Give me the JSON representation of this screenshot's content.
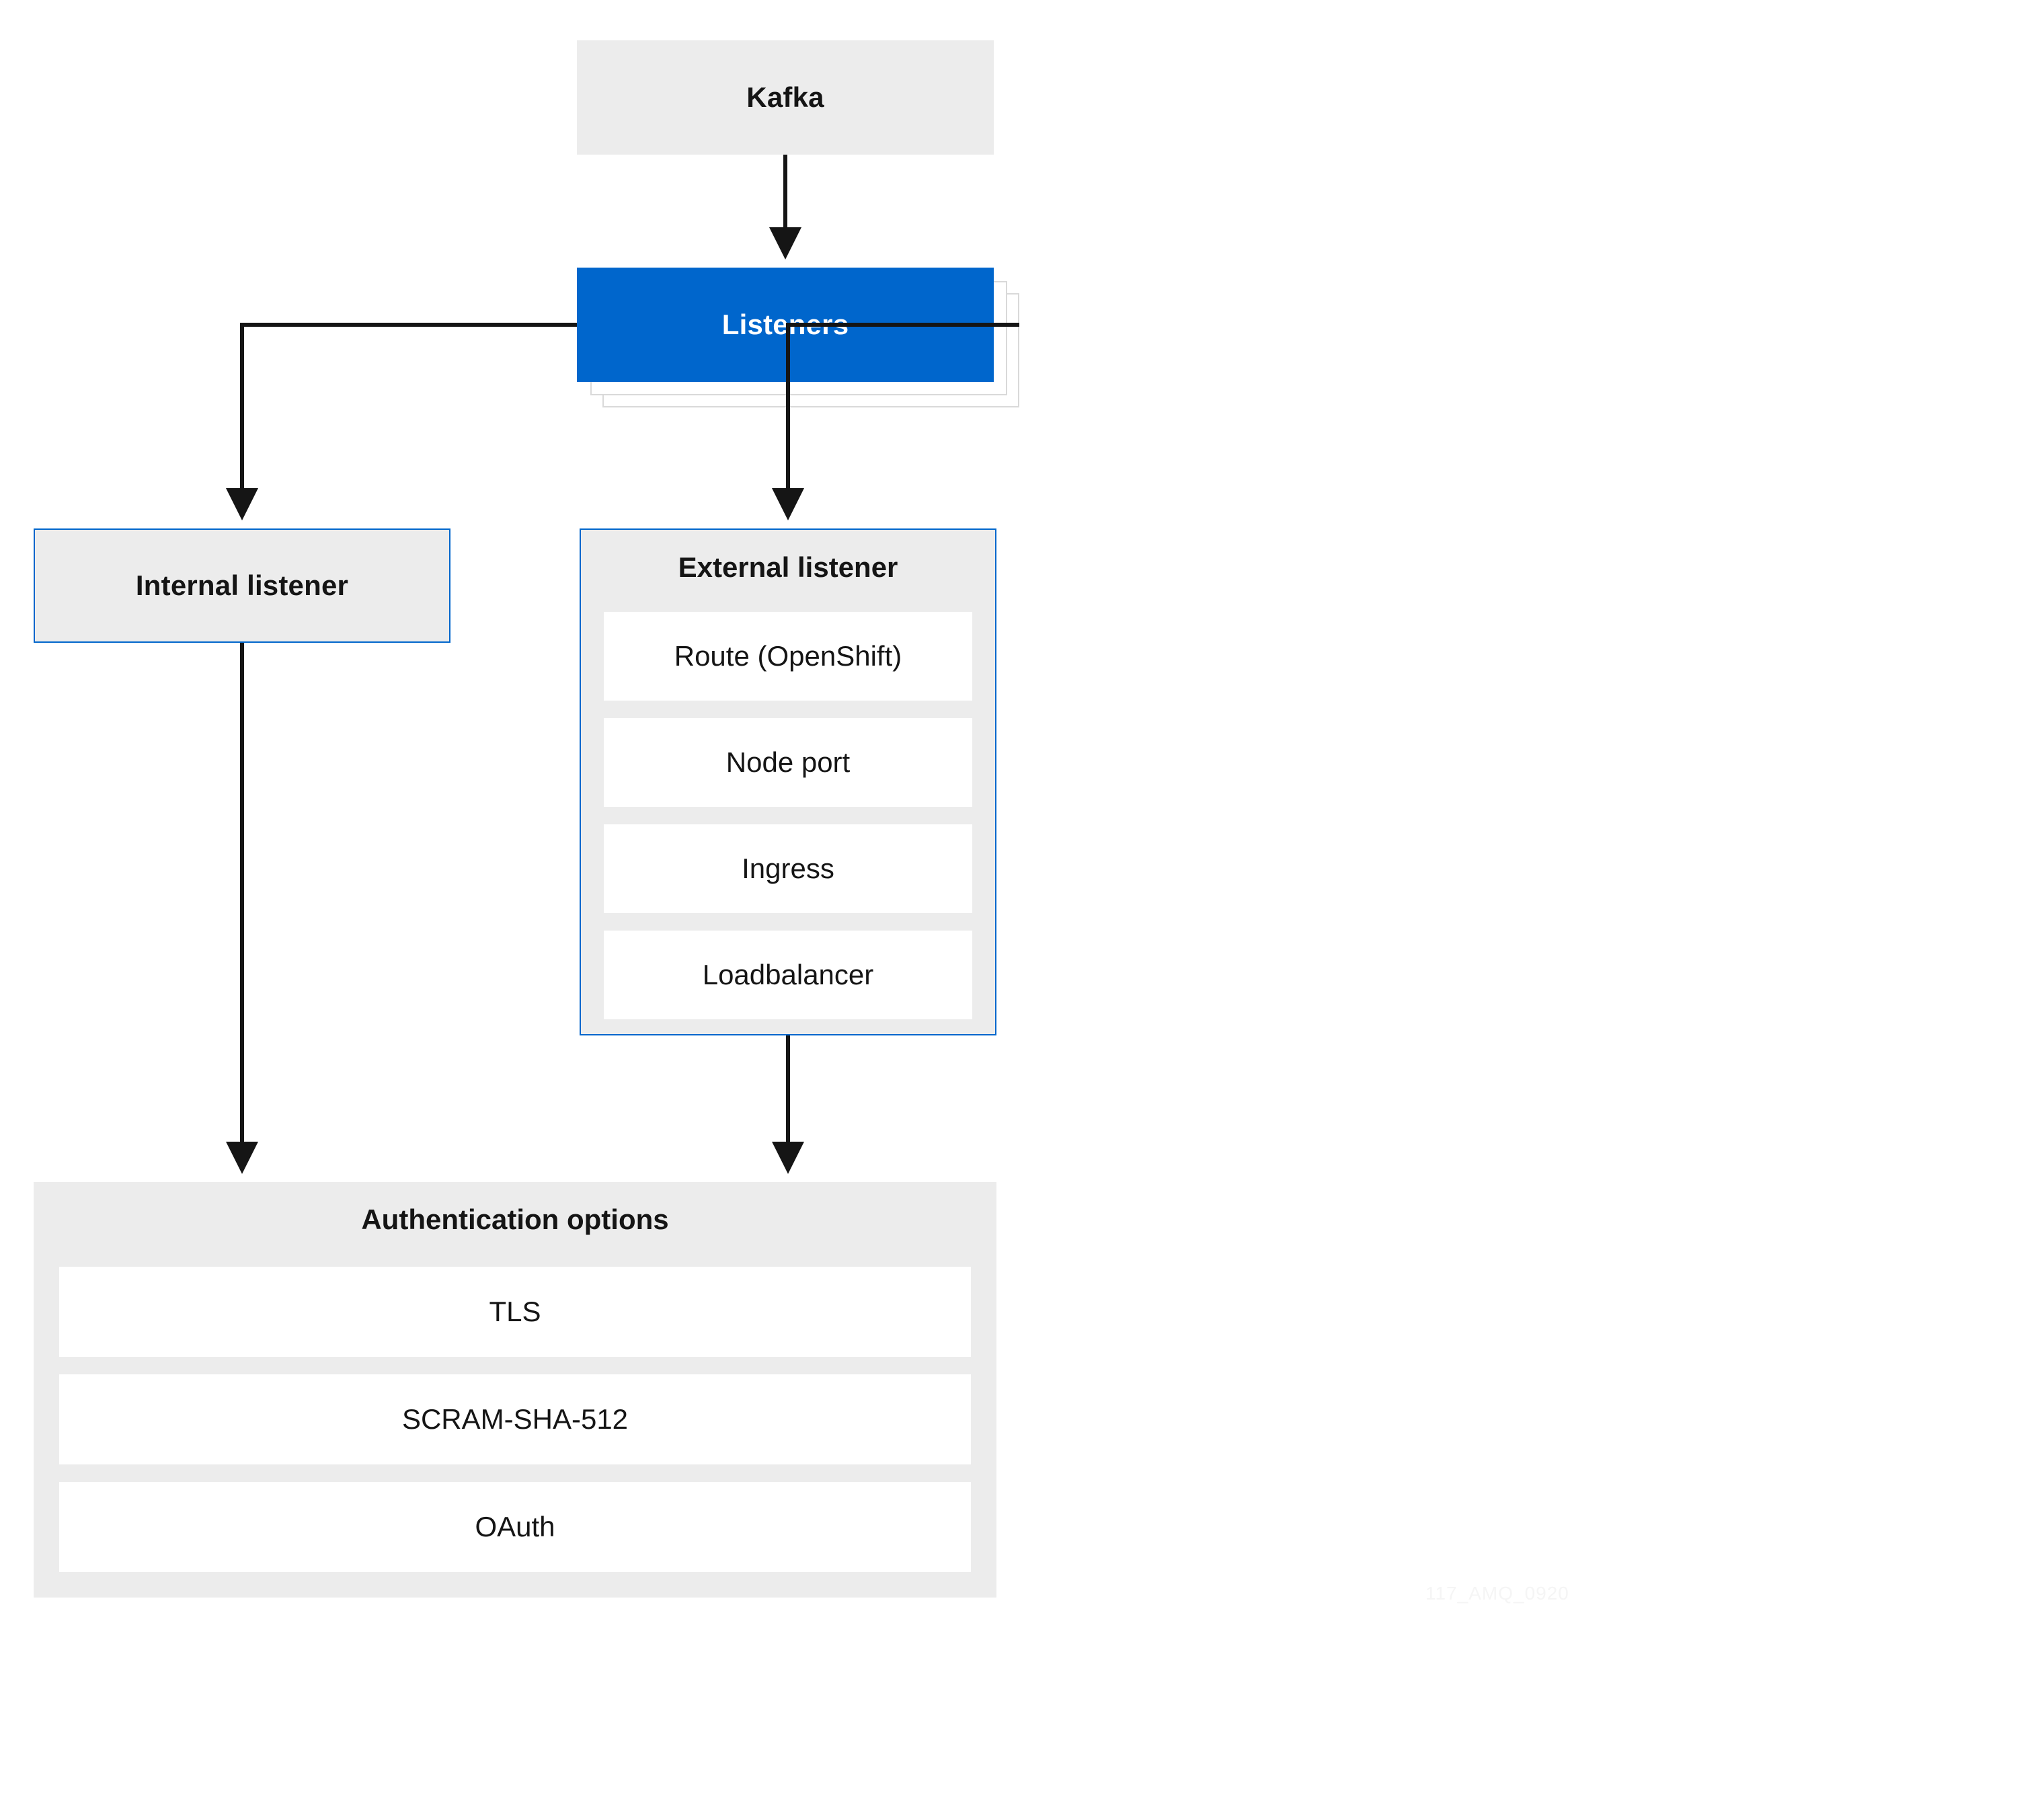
{
  "colors": {
    "gray_fill": "#ececec",
    "blue": "#0066cc",
    "stroke": "#151515"
  },
  "nodes": {
    "kafka": {
      "label": "Kafka"
    },
    "listeners": {
      "label": "Listeners"
    },
    "internal_listener": {
      "label": "Internal listener"
    },
    "external_listener": {
      "label": "External listener",
      "items": [
        "Route (OpenShift)",
        "Node port",
        "Ingress",
        "Loadbalancer"
      ]
    },
    "auth_options": {
      "label": "Authentication options",
      "items": [
        "TLS",
        "SCRAM-SHA-512",
        "OAuth"
      ]
    }
  },
  "watermark": "117_AMQ_0920"
}
